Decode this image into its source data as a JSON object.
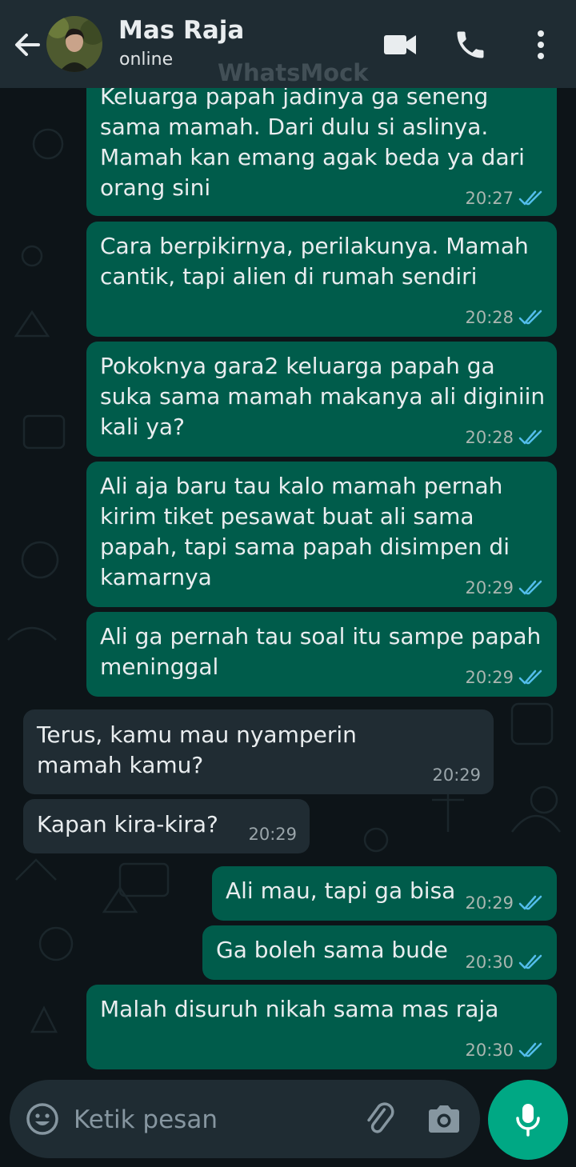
{
  "header": {
    "contact_name": "Mas Raja",
    "status": "online",
    "watermark": "WhatsMock",
    "bar_color": "#1f2c33"
  },
  "messages": [
    {
      "dir": "out",
      "text": "Keluarga papah jadinya ga seneng sama mamah. Dari dulu si aslinya. Mamah kan emang agak beda ya dari orang sini",
      "time": "20:27",
      "read": true
    },
    {
      "dir": "out",
      "text": "Cara berpikirnya, perilakunya. Mamah cantik, tapi alien di rumah sendiri",
      "time": "20:28",
      "read": true
    },
    {
      "dir": "out",
      "text": "Pokoknya gara2 keluarga papah ga suka sama mamah makanya ali diginiin kali ya?",
      "time": "20:28",
      "read": true
    },
    {
      "dir": "out",
      "text": "Ali aja baru tau kalo mamah pernah kirim tiket pesawat buat ali sama papah, tapi sama papah disimpen di kamarnya",
      "time": "20:29",
      "read": true
    },
    {
      "dir": "out",
      "text": "Ali ga pernah tau soal itu sampe papah meninggal",
      "time": "20:29",
      "read": true
    },
    {
      "dir": "in",
      "text": "Terus, kamu mau nyamperin mamah kamu?",
      "time": "20:29"
    },
    {
      "dir": "in",
      "text": "Kapan kira-kira?",
      "time": "20:29"
    },
    {
      "dir": "out",
      "text": "Ali mau, tapi ga bisa",
      "time": "20:29",
      "read": true
    },
    {
      "dir": "out",
      "text": "Ga boleh sama bude",
      "time": "20:30",
      "read": true
    },
    {
      "dir": "out",
      "text": "Malah disuruh nikah sama mas raja",
      "time": "20:30",
      "read": true
    }
  ],
  "composer": {
    "placeholder": "Ketik pesan"
  },
  "colors": {
    "outgoing_bubble": "#005c4b",
    "incoming_bubble": "#202c33",
    "read_ticks": "#53bdeb",
    "mic_button": "#00a884",
    "background": "#0d1418"
  },
  "icons": {
    "back": "arrow-left-icon",
    "video": "video-camera-icon",
    "call": "phone-icon",
    "menu": "more-vertical-icon",
    "emoji": "smiley-icon",
    "attach": "paperclip-icon",
    "camera": "camera-icon",
    "mic": "microphone-icon"
  }
}
